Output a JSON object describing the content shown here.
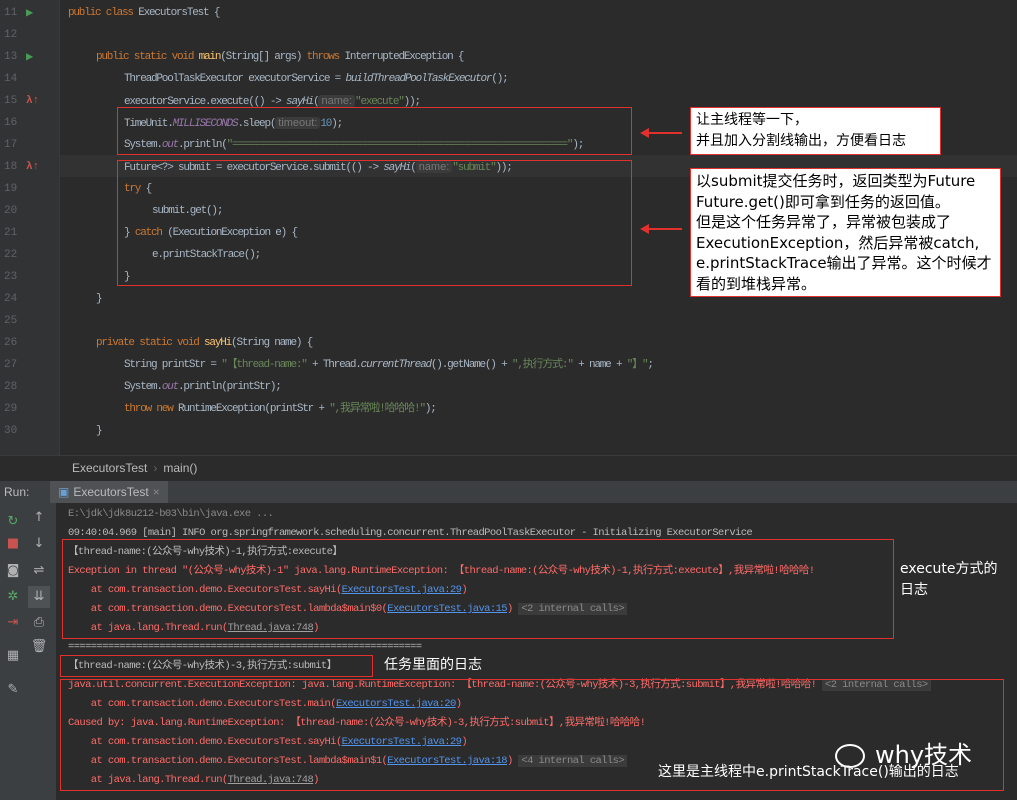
{
  "editor": {
    "lines": [
      {
        "n": "11",
        "indent": 0,
        "icon": "run",
        "tokens": [
          [
            "public class ",
            "kw"
          ],
          [
            "ExecutorsTest {",
            ""
          ]
        ]
      },
      {
        "n": "12",
        "indent": 0,
        "tokens": []
      },
      {
        "n": "13",
        "indent": 1,
        "icon": "run",
        "tokens": [
          [
            "public static void ",
            "kw"
          ],
          [
            "main",
            "fn"
          ],
          [
            "(String[] args) ",
            ""
          ],
          [
            "throws ",
            "kw"
          ],
          [
            "InterruptedException {",
            ""
          ]
        ]
      },
      {
        "n": "14",
        "indent": 2,
        "tokens": [
          [
            "ThreadPoolTaskExecutor executorService = ",
            ""
          ],
          [
            "buildThreadPoolTaskExecutor",
            "it"
          ],
          [
            "();",
            ""
          ]
        ]
      },
      {
        "n": "15",
        "indent": 2,
        "icon": "lambda",
        "tokens": [
          [
            "executorService.execute(() -> ",
            ""
          ],
          [
            "sayHi",
            "it"
          ],
          [
            "(",
            ""
          ],
          [
            "name:",
            "hint"
          ],
          [
            "\"execute\"",
            "str"
          ],
          [
            "));",
            ""
          ]
        ]
      },
      {
        "n": "16",
        "indent": 2,
        "tokens": [
          [
            "TimeUnit.",
            ""
          ],
          [
            "MILLISECONDS",
            "st"
          ],
          [
            ".sleep(",
            ""
          ],
          [
            "timeout:",
            "hint"
          ],
          [
            "10",
            "num"
          ],
          [
            ");",
            ""
          ]
        ]
      },
      {
        "n": "17",
        "indent": 2,
        "tokens": [
          [
            "System.",
            ""
          ],
          [
            "out",
            "st"
          ],
          [
            ".println(",
            ""
          ],
          [
            "\"==============================================================\"",
            "str"
          ],
          [
            ");",
            ""
          ]
        ]
      },
      {
        "n": "18",
        "indent": 2,
        "icon": "lambda",
        "tokens": [
          [
            "Future<?> submit = executorService.submit(() -> ",
            ""
          ],
          [
            "sayHi",
            "it"
          ],
          [
            "(",
            ""
          ],
          [
            "name:",
            "hint"
          ],
          [
            "\"submit\"",
            "str"
          ],
          [
            "));",
            ""
          ]
        ]
      },
      {
        "n": "19",
        "indent": 2,
        "tokens": [
          [
            "try ",
            "kw"
          ],
          [
            "{",
            ""
          ]
        ]
      },
      {
        "n": "20",
        "indent": 3,
        "tokens": [
          [
            "submit.get();",
            ""
          ]
        ]
      },
      {
        "n": "21",
        "indent": 2,
        "tokens": [
          [
            "} ",
            ""
          ],
          [
            "catch ",
            "kw"
          ],
          [
            "(ExecutionException e) {",
            ""
          ]
        ]
      },
      {
        "n": "22",
        "indent": 3,
        "tokens": [
          [
            "e.printStackTrace();",
            ""
          ]
        ]
      },
      {
        "n": "23",
        "indent": 2,
        "tokens": [
          [
            "}",
            ""
          ]
        ]
      },
      {
        "n": "24",
        "indent": 1,
        "tokens": [
          [
            "}",
            ""
          ]
        ]
      },
      {
        "n": "25",
        "indent": 0,
        "tokens": []
      },
      {
        "n": "26",
        "indent": 1,
        "tokens": [
          [
            "private static void ",
            "kw"
          ],
          [
            "sayHi",
            "fn"
          ],
          [
            "(String name) {",
            ""
          ]
        ]
      },
      {
        "n": "27",
        "indent": 2,
        "tokens": [
          [
            "String printStr = ",
            ""
          ],
          [
            "\"【thread-name:\"",
            "str"
          ],
          [
            " + Thread.",
            ""
          ],
          [
            "currentThread",
            "it"
          ],
          [
            "().getName() + ",
            ""
          ],
          [
            "\",执行方式:\"",
            "str"
          ],
          [
            " + name + ",
            ""
          ],
          [
            "\"】\"",
            "str"
          ],
          [
            ";",
            ""
          ]
        ]
      },
      {
        "n": "28",
        "indent": 2,
        "tokens": [
          [
            "System.",
            ""
          ],
          [
            "out",
            "st"
          ],
          [
            ".println(printStr);",
            ""
          ]
        ]
      },
      {
        "n": "29",
        "indent": 2,
        "tokens": [
          [
            "throw new ",
            "kw"
          ],
          [
            "RuntimeException(printStr + ",
            ""
          ],
          [
            "\",我异常啦!哈哈哈!\"",
            "str"
          ],
          [
            ");",
            ""
          ]
        ]
      },
      {
        "n": "30",
        "indent": 1,
        "tokens": [
          [
            "}",
            ""
          ]
        ]
      }
    ]
  },
  "notes": {
    "sleep": [
      "让主线程等一下，",
      "并且加入分割线输出，方便看日志"
    ],
    "submit": [
      "以submit提交任务时，返回类型为Future",
      "Future.get()即可拿到任务的返回值。",
      "但是这个任务异常了，异常被包装成了",
      "ExecutionException，然后异常被catch,",
      "e.printStackTrace输出了异常。这个时候才",
      "看的到堆栈异常。"
    ],
    "execute_log": [
      "execute方式的",
      "日志"
    ],
    "task_log": "任务里面的日志",
    "main_log": "这里是主线程中e.printStackTrace()输出的日志"
  },
  "breadcrumb": [
    "ExecutorsTest",
    "main()"
  ],
  "run": {
    "label": "Run:",
    "tab": "ExecutorsTest"
  },
  "console": [
    [
      [
        "E:\\jdk\\jdk8u212-b03\\bin\\java.exe ...",
        "gray"
      ]
    ],
    [
      [
        "09:40:04.969 [main] INFO org.springframework.scheduling.concurrent.ThreadPoolTaskExecutor - Initializing ExecutorService",
        "norm"
      ]
    ],
    [
      [
        "【thread-name:(公众号-why技术)-1,执行方式:execute】",
        "norm"
      ]
    ],
    [
      [
        "Exception in thread \"(公众号-why技术)-1\" java.lang.RuntimeException: 【thread-name:(公众号-why技术)-1,执行方式:execute】,我异常啦!哈哈哈!",
        "err"
      ]
    ],
    [
      [
        "    at com.transaction.demo.ExecutorsTest.sayHi(",
        "err"
      ],
      [
        "ExecutorsTest.java:29",
        "link"
      ],
      [
        ")",
        "err"
      ]
    ],
    [
      [
        "    at com.transaction.demo.ExecutorsTest.lambda$main$0(",
        "err"
      ],
      [
        "ExecutorsTest.java:15",
        "link"
      ],
      [
        ") ",
        "err"
      ],
      [
        "<2 internal calls>",
        "ic"
      ]
    ],
    [
      [
        "    at java.lang.Thread.run(",
        "err"
      ],
      [
        "Thread.java:748",
        "link2"
      ],
      [
        ")",
        "err"
      ]
    ],
    [
      [
        "==============================================================",
        "norm"
      ]
    ],
    [
      [
        "【thread-name:(公众号-why技术)-3,执行方式:submit】",
        "norm"
      ]
    ],
    [
      [
        "java.util.concurrent.ExecutionException: java.lang.RuntimeException: 【thread-name:(公众号-why技术)-3,执行方式:submit】,我异常啦!哈哈哈! ",
        "err"
      ],
      [
        "<2 internal calls>",
        "ic"
      ]
    ],
    [
      [
        "    at com.transaction.demo.ExecutorsTest.main(",
        "err"
      ],
      [
        "ExecutorsTest.java:20",
        "link"
      ],
      [
        ")",
        "err"
      ]
    ],
    [
      [
        "Caused by: java.lang.RuntimeException: 【thread-name:(公众号-why技术)-3,执行方式:submit】,我异常啦!哈哈哈!",
        "err"
      ]
    ],
    [
      [
        "    at com.transaction.demo.ExecutorsTest.sayHi(",
        "err"
      ],
      [
        "ExecutorsTest.java:29",
        "link"
      ],
      [
        ")",
        "err"
      ]
    ],
    [
      [
        "    at com.transaction.demo.ExecutorsTest.lambda$main$1(",
        "err"
      ],
      [
        "ExecutorsTest.java:18",
        "link"
      ],
      [
        ") ",
        "err"
      ],
      [
        "<4 internal calls>",
        "ic"
      ]
    ],
    [
      [
        "    at java.lang.Thread.run(",
        "err"
      ],
      [
        "Thread.java:748",
        "link2"
      ],
      [
        ")",
        "err"
      ]
    ]
  ],
  "watermark": "why技术",
  "colors": {
    "keyword": "#cc7832",
    "method": "#ffc66d",
    "string": "#6a8759",
    "error": "#ff6b68",
    "annotation": "#e0312c",
    "link": "#5394ec"
  }
}
